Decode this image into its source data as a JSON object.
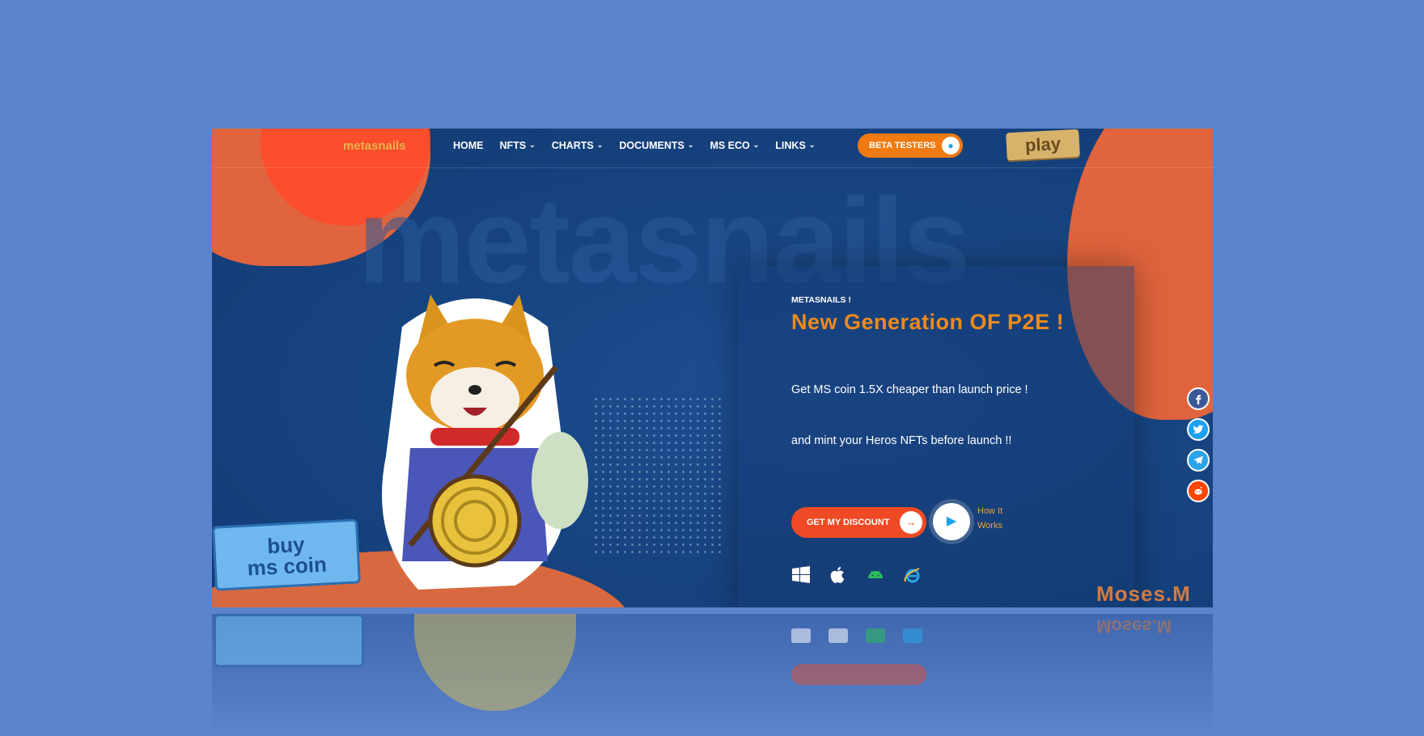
{
  "nav": {
    "logo": "metasnails",
    "items": [
      {
        "label": "HOME",
        "dropdown": false
      },
      {
        "label": "NFTS",
        "dropdown": true
      },
      {
        "label": "CHARTS",
        "dropdown": true
      },
      {
        "label": "DOCUMENTS",
        "dropdown": true
      },
      {
        "label": "MS ECO",
        "dropdown": true
      },
      {
        "label": "LINKS",
        "dropdown": true
      }
    ],
    "beta_button": "BETA TESTERS",
    "play_sign": "play"
  },
  "hero": {
    "watermark": "metasnails",
    "eyebrow": "METASNAILS !",
    "headline": "New Generation OF P2E !",
    "para1": "Get MS coin 1.5X cheaper than launch price !",
    "para2": "and mint your Heros NFTs before launch !!",
    "cta": "GET MY DISCOUNT",
    "how_it_works": "How It Works",
    "buy_sign_line1": "buy",
    "buy_sign_line2": "ms coin",
    "signature": "Moses.M",
    "platforms": [
      "windows-icon",
      "apple-icon",
      "android-icon",
      "internet-explorer-icon"
    ]
  },
  "social": [
    "facebook-icon",
    "twitter-icon",
    "telegram-icon",
    "reddit-icon"
  ],
  "colors": {
    "background": "#5b84cc",
    "accent_orange": "#ef8a1a",
    "cta_red": "#ef4a25",
    "beta_orange": "#f07a10",
    "facebook": "#3b5998",
    "twitter": "#1da1f2",
    "telegram": "#2aa5e8",
    "reddit": "#ff4500"
  }
}
